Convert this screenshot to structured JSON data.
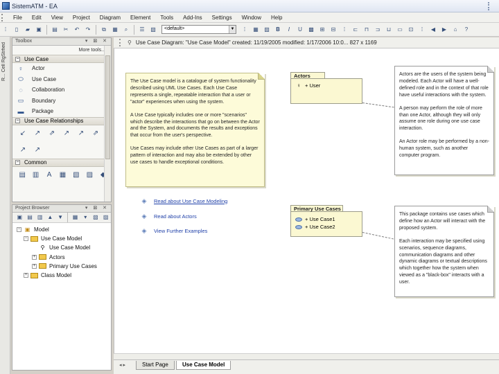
{
  "window": {
    "title": "SistemATM - EA"
  },
  "menu": [
    "File",
    "Edit",
    "View",
    "Project",
    "Diagram",
    "Element",
    "Tools",
    "Add-Ins",
    "Settings",
    "Window",
    "Help"
  ],
  "toolbar": {
    "combo_value": "<default>"
  },
  "side_strip": {
    "label": "R... Cell RgStrfied"
  },
  "toolbox": {
    "title": "Toolbox",
    "more_tools": "More tools...",
    "groups": {
      "use_case": {
        "label": "Use Case",
        "items": [
          {
            "label": "Actor",
            "icon": "actor-icon"
          },
          {
            "label": "Use Case",
            "icon": "use-case-icon"
          },
          {
            "label": "Collaboration",
            "icon": "collaboration-icon"
          },
          {
            "label": "Boundary",
            "icon": "boundary-icon"
          },
          {
            "label": "Package",
            "icon": "package-icon"
          }
        ]
      },
      "relationships": {
        "label": "Use Case Relationships"
      },
      "common": {
        "label": "Common"
      }
    }
  },
  "browser": {
    "title": "Project Browser",
    "tree": [
      {
        "label": "Model",
        "level": 0,
        "icon": "model-icon"
      },
      {
        "label": "Use Case Model",
        "level": 1,
        "icon": "package-icon"
      },
      {
        "label": "Use Case Model",
        "level": 2,
        "icon": "diagram-icon"
      },
      {
        "label": "Actors",
        "level": 2,
        "icon": "folder-icon"
      },
      {
        "label": "Primary Use Cases",
        "level": 2,
        "icon": "folder-icon"
      },
      {
        "label": "Class Model",
        "level": 1,
        "icon": "package-icon"
      }
    ]
  },
  "diagram": {
    "header": "Use Case Diagram: \"Use Case Model\"   created: 11/19/2005  modified: 1/17/2006  10:0...  827 x 1169",
    "main_note": [
      "The Use Case model is a catalogue of system functionality described using UML Use Cases. Each Use Case represents a single, repeatable interaction that a user or \"actor\" experiences when using the system.",
      "A Use Case typically includes one or more \"scenarios\" which describe the interactions that go on between the Actor and the System, and documents the results and exceptions that occur from the user's perspective.",
      "Use Cases may include other Use Cases as part of a larger pattern of interaction and may also be extended by other use cases to handle exceptional conditions."
    ],
    "actors_package": {
      "name": "Actors",
      "items": [
        "+ User"
      ]
    },
    "actors_note": [
      "Actors are the users of the system being modeled. Each Actor will have a well-defined role and in the context of that role have useful interactions with the system.",
      "A person may perform the role of more than one Actor, although they will only assume one role during one use case interaction.",
      "An Actor role may be performed by a non-human system, such as another computer program."
    ],
    "primary_package": {
      "name": "Primary Use Cases",
      "items": [
        "+ Use Case1",
        "+ Use Case2"
      ]
    },
    "primary_note": [
      "This package contains use cases which define how an Actor will interact with the proposed system.",
      "Each interaction may be specified using scenarios, sequence diagrams, communication diagrams and other dynamic diagrams or textual descriptions which together how the system when viewed as a \"black-box\" interacts with a user."
    ],
    "links": [
      "Read about Use Case Modeling",
      "Read about Actors",
      "View Further Examples"
    ]
  },
  "tabs": [
    "Start Page",
    "Use Case Model"
  ]
}
